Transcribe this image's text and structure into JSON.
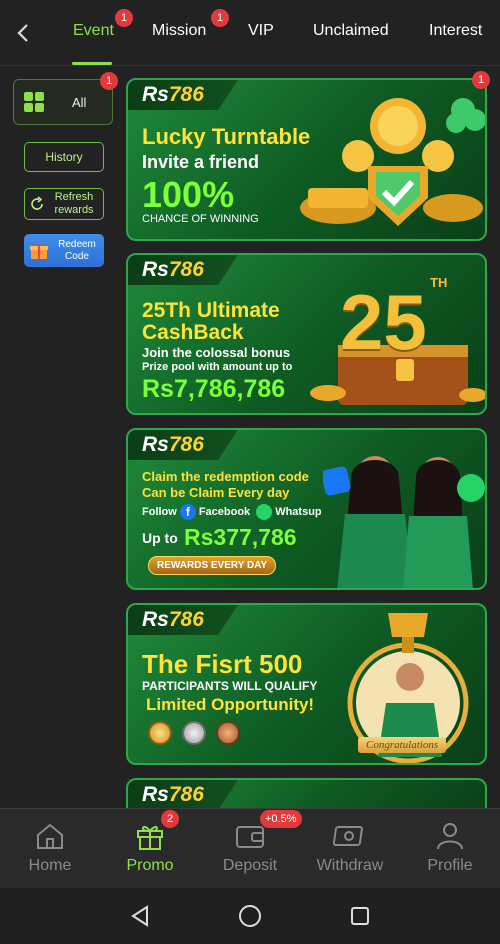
{
  "tabs": [
    {
      "label": "Event",
      "badge": "1",
      "active": true
    },
    {
      "label": "Mission",
      "badge": "1"
    },
    {
      "label": "VIP"
    },
    {
      "label": "Unclaimed"
    },
    {
      "label": "Interest"
    }
  ],
  "sidebar": {
    "all": {
      "label": "All",
      "badge": "1"
    },
    "history": {
      "label": "History"
    },
    "refresh": {
      "label": "Refresh rewards"
    },
    "redeem": {
      "label": "Redeem Code"
    }
  },
  "banners": [
    {
      "badge": "1",
      "logo": {
        "rs": "Rs",
        "num": "786"
      },
      "line1": "Lucky Turntable",
      "line2": "Invite a friend",
      "big": "100%",
      "small": "CHANCE OF WINNING"
    },
    {
      "logo": {
        "rs": "Rs",
        "num": "786"
      },
      "line1": "25Th Ultimate",
      "line2": "CashBack",
      "line3": "Join the colossal bonus",
      "line4": "Prize pool with amount up to",
      "big": "Rs7,786,786",
      "art_num": "25",
      "art_sup": "TH"
    },
    {
      "logo": {
        "rs": "Rs",
        "num": "786"
      },
      "line1": "Claim the redemption code",
      "line2": "Can be Claim Every day",
      "follow": "Follow",
      "facebook": "Facebook",
      "whatsup": "Whatsup",
      "upto": "Up to",
      "big": "Rs377,786",
      "pill": "REWARDS EVERY DAY"
    },
    {
      "logo": {
        "rs": "Rs",
        "num": "786"
      },
      "line1": "The Fisrt 500",
      "line2": "PARTICIPANTS WILL QUALIFY",
      "line3": "Limited Opportunity!",
      "ribbon": "Congratulations"
    },
    {
      "logo": {
        "rs": "Rs",
        "num": "786"
      }
    }
  ],
  "bottom_nav": [
    {
      "label": "Home",
      "icon": "home-icon"
    },
    {
      "label": "Promo",
      "icon": "gift-icon",
      "badge": "2",
      "active": true
    },
    {
      "label": "Deposit",
      "icon": "wallet-icon",
      "badge": "+0.5%"
    },
    {
      "label": "Withdraw",
      "icon": "cash-icon"
    },
    {
      "label": "Profile",
      "icon": "person-icon"
    }
  ],
  "colors": {
    "accent": "#8ee04a",
    "badge": "#e23a3a",
    "banner_green": "#1f8a3a",
    "gold": "#ffd233"
  }
}
